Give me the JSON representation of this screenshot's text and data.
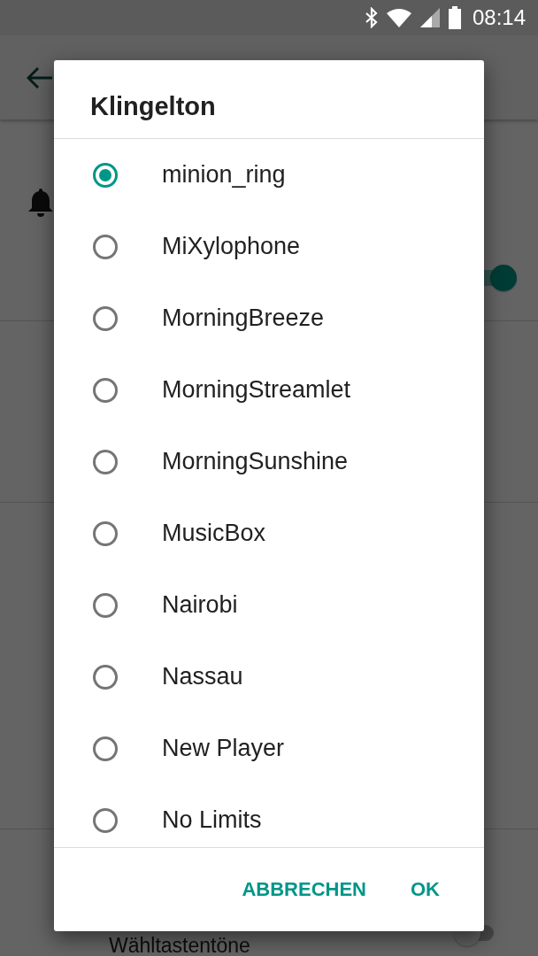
{
  "status_bar": {
    "time": "08:14"
  },
  "background": {
    "toggles": [
      {
        "checked": true
      },
      {
        "checked": false
      }
    ],
    "bottom_label": "Wähltastentöne"
  },
  "dialog": {
    "title": "Klingelton",
    "options": [
      {
        "label": "minion_ring",
        "selected": true
      },
      {
        "label": "MiXylophone",
        "selected": false
      },
      {
        "label": "MorningBreeze",
        "selected": false
      },
      {
        "label": "MorningStreamlet",
        "selected": false
      },
      {
        "label": "MorningSunshine",
        "selected": false
      },
      {
        "label": "MusicBox",
        "selected": false
      },
      {
        "label": "Nairobi",
        "selected": false
      },
      {
        "label": "Nassau",
        "selected": false
      },
      {
        "label": "New Player",
        "selected": false
      },
      {
        "label": "No Limits",
        "selected": false
      }
    ],
    "buttons": [
      "ABBRECHEN",
      "OK"
    ]
  }
}
